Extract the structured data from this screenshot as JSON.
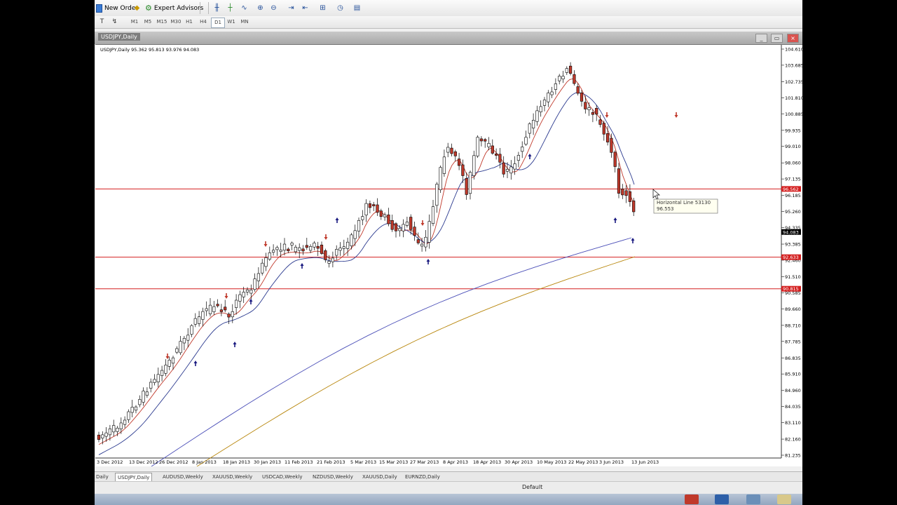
{
  "toolbar": {
    "new_order_label": "New Order",
    "expert_advisors_label": "Expert Advisors",
    "timeframes": [
      "M1",
      "M5",
      "M15",
      "M30",
      "H1",
      "H4",
      "D1",
      "W1",
      "MN"
    ]
  },
  "window": {
    "title": "USDJPY,Daily"
  },
  "chart": {
    "info_label": "USDJPY,Daily  95.362 95.813 93.976 94.083",
    "hline_tooltip_name": "Horizontal Line 53130",
    "hline_tooltip_value": "96.553",
    "price_labels": [
      "104.610",
      "103.685",
      "102.735",
      "101.810",
      "100.885",
      "99.935",
      "99.010",
      "98.060",
      "97.135",
      "96.185",
      "95.260",
      "94.335",
      "93.385",
      "92.460",
      "91.510",
      "90.585",
      "89.660",
      "88.710",
      "87.785",
      "86.835",
      "85.910",
      "84.960",
      "84.035",
      "83.110",
      "82.160",
      "81.235"
    ],
    "date_labels": [
      "3 Dec 2012",
      "13 Dec 2012",
      "26 Dec 2012",
      "8 Jan 2013",
      "18 Jan 2013",
      "30 Jan 2013",
      "11 Feb 2013",
      "21 Feb 2013",
      "5 Mar 2013",
      "15 Mar 2013",
      "27 Mar 2013",
      "8 Apr 2013",
      "18 Apr 2013",
      "30 Apr 2013",
      "10 May 2013",
      "22 May 2013",
      "3 Jun 2013",
      "13 Jun 2013"
    ],
    "hline_badges": [
      "96.562",
      "92.633",
      "90.815"
    ],
    "current_price_badge": "94.083",
    "colors": {
      "hline": "#d42020",
      "bull": "#ffffff",
      "bear": "#c0392b",
      "ma_fast": "#c0392b",
      "ma_mid": "#2b3a8f",
      "ma_slow_blue": "#4b4fb8",
      "ma_slow_gold": "#b8860b"
    }
  },
  "tabs": {
    "items": [
      "Daily",
      "USDJPY,Daily",
      "AUDUSD,Weekly",
      "XAUUSD,Weekly",
      "USDCAD,Weekly",
      "NZDUSD,Weekly",
      "XAUUSD,Daily",
      "EURNZD,Daily"
    ],
    "active_index": 1
  },
  "status": {
    "profile": "Default"
  }
}
